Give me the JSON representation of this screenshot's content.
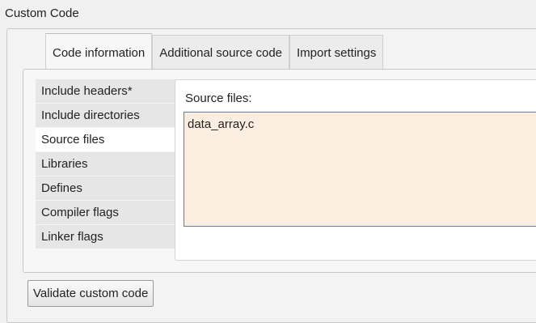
{
  "group": {
    "title": "Custom Code"
  },
  "tabs": [
    {
      "label": "Code information",
      "active": true
    },
    {
      "label": "Additional source code",
      "active": false
    },
    {
      "label": "Import settings",
      "active": false
    }
  ],
  "sidebar": {
    "items": [
      {
        "label": "Include headers*",
        "active": false
      },
      {
        "label": "Include directories",
        "active": false
      },
      {
        "label": "Source files",
        "active": true
      },
      {
        "label": "Libraries",
        "active": false
      },
      {
        "label": "Defines",
        "active": false
      },
      {
        "label": "Compiler flags",
        "active": false
      },
      {
        "label": "Linker flags",
        "active": false
      }
    ]
  },
  "source_panel": {
    "label": "Source files:",
    "value": "data_array.c",
    "background_color": "#fbeee0",
    "border_color": "#5c7ea3"
  },
  "actions": {
    "validate_label": "Validate custom code"
  }
}
